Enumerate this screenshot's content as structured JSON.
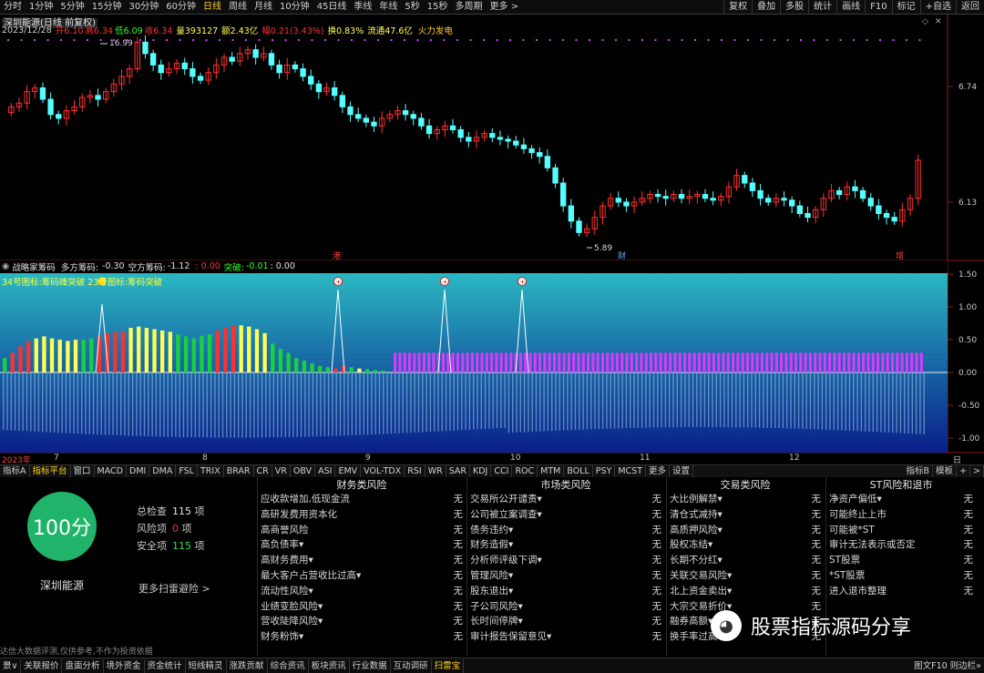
{
  "topbar": {
    "periods": [
      "分时",
      "1分钟",
      "5分钟",
      "15分钟",
      "30分钟",
      "60分钟",
      "日线",
      "周线",
      "月线",
      "10分钟",
      "45日线",
      "季线",
      "年线",
      "5秒",
      "15秒",
      "多周期",
      "更多 >"
    ],
    "active_period": "日线",
    "right_buttons": [
      "复权",
      "叠加",
      "多股",
      "统计",
      "画线",
      "F10",
      "标记",
      "+自选",
      "返回"
    ]
  },
  "chart": {
    "title": "深圳能源(日线 前复权)",
    "info": {
      "date": "2023/12/28",
      "open": "开6.10",
      "high": "高6.34",
      "low": "低6.09",
      "close": "收6.34",
      "volume": "量393127",
      "amount": "额2.43亿",
      "change": "幅0.21(3.43%)",
      "turnover": "换0.83%",
      "float": "流通47.6亿",
      "concept": "火力发电"
    },
    "price_axis": [
      "6.74",
      "6.13"
    ],
    "high_marker": "16.99",
    "low_marker": "5.89",
    "event_markers": [
      "港",
      "财",
      "增"
    ]
  },
  "indicator": {
    "name": "战略家筹码",
    "long_chip_label": "多方筹码:",
    "long_chip": "-0.30",
    "short_chip_label": "空方筹码:",
    "short_chip": "-1.12",
    "mid": ": 0.00",
    "breakout_label": "突破:",
    "breakout": "-0.01",
    "end": ": 0.00",
    "legend": "34号图标:筹码峰突破 23号图标:筹码突破",
    "axis": [
      "1.50",
      "1.00",
      "0.50",
      "0.00",
      "-0.50",
      "-1.00",
      "-1.50"
    ]
  },
  "date_axis": {
    "year": "2023年",
    "months": [
      "7",
      "8",
      "9",
      "10",
      "11",
      "12"
    ],
    "period": "日线"
  },
  "indicator_tabs": {
    "items": [
      "指标A",
      "指标平台",
      "窗口",
      "MACD",
      "DMI",
      "DMA",
      "FSL",
      "TRIX",
      "BRAR",
      "CR",
      "VR",
      "OBV",
      "ASI",
      "EMV",
      "VOL-TDX",
      "RSI",
      "WR",
      "SAR",
      "KDJ",
      "CCI",
      "ROC",
      "MTM",
      "BOLL",
      "PSY",
      "MCST",
      "更多",
      "设置"
    ],
    "active": "指标平台",
    "right": [
      "指标B",
      "模板",
      "+",
      ">"
    ]
  },
  "risk": {
    "score": "100分",
    "stock_name": "深圳能源",
    "total_label": "总检查",
    "total": "115",
    "risk_label": "风险项",
    "risk_count": "0",
    "safe_label": "安全项",
    "safe_count": "115",
    "unit": "项",
    "more_link": "更多扫雷避险 >",
    "disclaimer": "达信大数据评测,仅供参考,不作为投资依据",
    "columns": [
      {
        "title": "财务类风险",
        "items": [
          "应收款增加,低现金流",
          "高研发费用资本化",
          "高商誉风险",
          "高负债率▾",
          "高财务费用▾",
          "最大客户占营收比过高▾",
          "流动性风险▾",
          "业绩变脸风险▾",
          "营收陡降风险▾",
          "财务粉饰▾"
        ]
      },
      {
        "title": "市场类风险",
        "items": [
          "交易所公开谴责▾",
          "公司被立案调查▾",
          "债务违约▾",
          "财务造假▾",
          "分析师评级下调▾",
          "管理风险▾",
          "股东退出▾",
          "子公司风险▾",
          "长时间停牌▾",
          "审计报告保留意见▾"
        ]
      },
      {
        "title": "交易类风险",
        "items": [
          "大比例解禁▾",
          "清仓式减持▾",
          "高质押风险▾",
          "股权冻结▾",
          "长期不分红▾",
          "关联交易风险▾",
          "北上资金卖出▾",
          "大宗交易折价▾",
          "融券高额▾",
          "换手率过高▾"
        ]
      },
      {
        "title": "ST风险和退市",
        "items": [
          "净资产偏低▾",
          "可能终止上市",
          "可能被*ST",
          "审计无法表示或否定",
          "ST股票",
          "*ST股票",
          "进入退市整理"
        ]
      }
    ],
    "value": "无"
  },
  "footer": {
    "items": [
      "景∨",
      "关联报价",
      "盘面分析",
      "境外资金",
      "资金统计",
      "短线精灵",
      "涨跌贡献",
      "综合资讯",
      "板块资讯",
      "行业数据",
      "互动调研",
      "扫雷宝"
    ],
    "active": "扫雷宝",
    "right": "图文F10 则边栏»"
  },
  "watermark": {
    "text": "股票指标源码分享"
  },
  "colors": {
    "up": "#ff3030",
    "down": "#54ffff",
    "accent": "#ffd21e",
    "score_bg": "#1fb46a",
    "magenta": "#d63bff"
  },
  "chart_data": {
    "type": "candlestick",
    "title": "深圳能源(日线 前复权)",
    "y_ticks": [
      6.74,
      6.13
    ],
    "x_months": [
      "7",
      "8",
      "9",
      "10",
      "11",
      "12"
    ],
    "high_marker": 6.99,
    "low_marker": 5.89,
    "last_close": 6.34,
    "closes": [
      6.62,
      6.64,
      6.7,
      6.72,
      6.66,
      6.58,
      6.56,
      6.6,
      6.62,
      6.67,
      6.68,
      6.66,
      6.7,
      6.74,
      6.78,
      6.82,
      6.96,
      6.9,
      6.84,
      6.8,
      6.82,
      6.85,
      6.82,
      6.78,
      6.76,
      6.8,
      6.84,
      6.88,
      6.86,
      6.9,
      6.92,
      6.88,
      6.9,
      6.84,
      6.8,
      6.84,
      6.82,
      6.78,
      6.74,
      6.7,
      6.72,
      6.68,
      6.62,
      6.58,
      6.56,
      6.54,
      6.52,
      6.56,
      6.58,
      6.6,
      6.58,
      6.56,
      6.52,
      6.48,
      6.5,
      6.52,
      6.5,
      6.46,
      6.44,
      6.46,
      6.48,
      6.46,
      6.45,
      6.44,
      6.42,
      6.4,
      6.38,
      6.36,
      6.3,
      6.22,
      6.1,
      6.02,
      5.96,
      5.98,
      6.04,
      6.1,
      6.14,
      6.12,
      6.1,
      6.12,
      6.14,
      6.16,
      6.15,
      6.14,
      6.16,
      6.14,
      6.15,
      6.16,
      6.14,
      6.13,
      6.15,
      6.2,
      6.26,
      6.22,
      6.18,
      6.14,
      6.12,
      6.14,
      6.13,
      6.1,
      6.06,
      6.04,
      6.08,
      6.14,
      6.18,
      6.16,
      6.2,
      6.18,
      6.14,
      6.1,
      6.06,
      6.04,
      6.02,
      6.08,
      6.14,
      6.34
    ]
  }
}
